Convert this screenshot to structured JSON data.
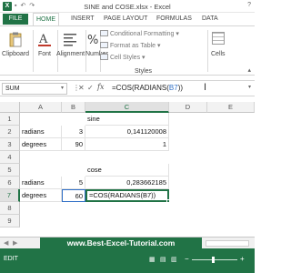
{
  "window": {
    "title": "SINE and COSE.xlsx - Excel",
    "help": "?"
  },
  "ribbon": {
    "tabs": [
      {
        "label": "FILE"
      },
      {
        "label": "HOME"
      },
      {
        "label": "INSERT"
      },
      {
        "label": "PAGE LAYOUT"
      },
      {
        "label": "FORMULAS"
      },
      {
        "label": "DATA"
      }
    ],
    "active_tab": "HOME",
    "groups": {
      "clipboard": "Clipboard",
      "font": "Font",
      "alignment": "Alignment",
      "number": "Number",
      "cells": "Cells"
    },
    "styles": {
      "conditional_formatting": "Conditional Formatting ",
      "format_as_table": "Format as Table ",
      "cell_styles": "Cell Styles ",
      "group_label": "Styles"
    }
  },
  "formula_bar": {
    "name_box": "SUM",
    "cancel_icon": "✕",
    "enter_icon": "✓",
    "fx_label": "fx",
    "formula_prefix": "=COS(RADIANS(",
    "formula_ref": "B7",
    "formula_suffix": "))"
  },
  "grid": {
    "columns": [
      "A",
      "B",
      "C",
      "D",
      "E"
    ],
    "rows": [
      "1",
      "2",
      "3",
      "4",
      "5",
      "6",
      "7",
      "8",
      "9"
    ],
    "cells": {
      "C1": "sine",
      "A2": "radians",
      "B2": "3",
      "C2": "0,141120008",
      "A3": "degrees",
      "B3": "90",
      "C3": "1",
      "C5": "cose",
      "A6": "radians",
      "B6": "5",
      "C6": "0,283662185",
      "A7": "degrees",
      "B7": "60",
      "C7": "=COS(RADIANS(B7))"
    },
    "selected_row": "7",
    "selected_col": "C"
  },
  "sheet_bar": {
    "watermark": "www.Best-Excel-Tutorial.com"
  },
  "status_bar": {
    "mode": "EDIT"
  },
  "colors": {
    "accent": "#217346",
    "reference": "#2f6fc6"
  }
}
